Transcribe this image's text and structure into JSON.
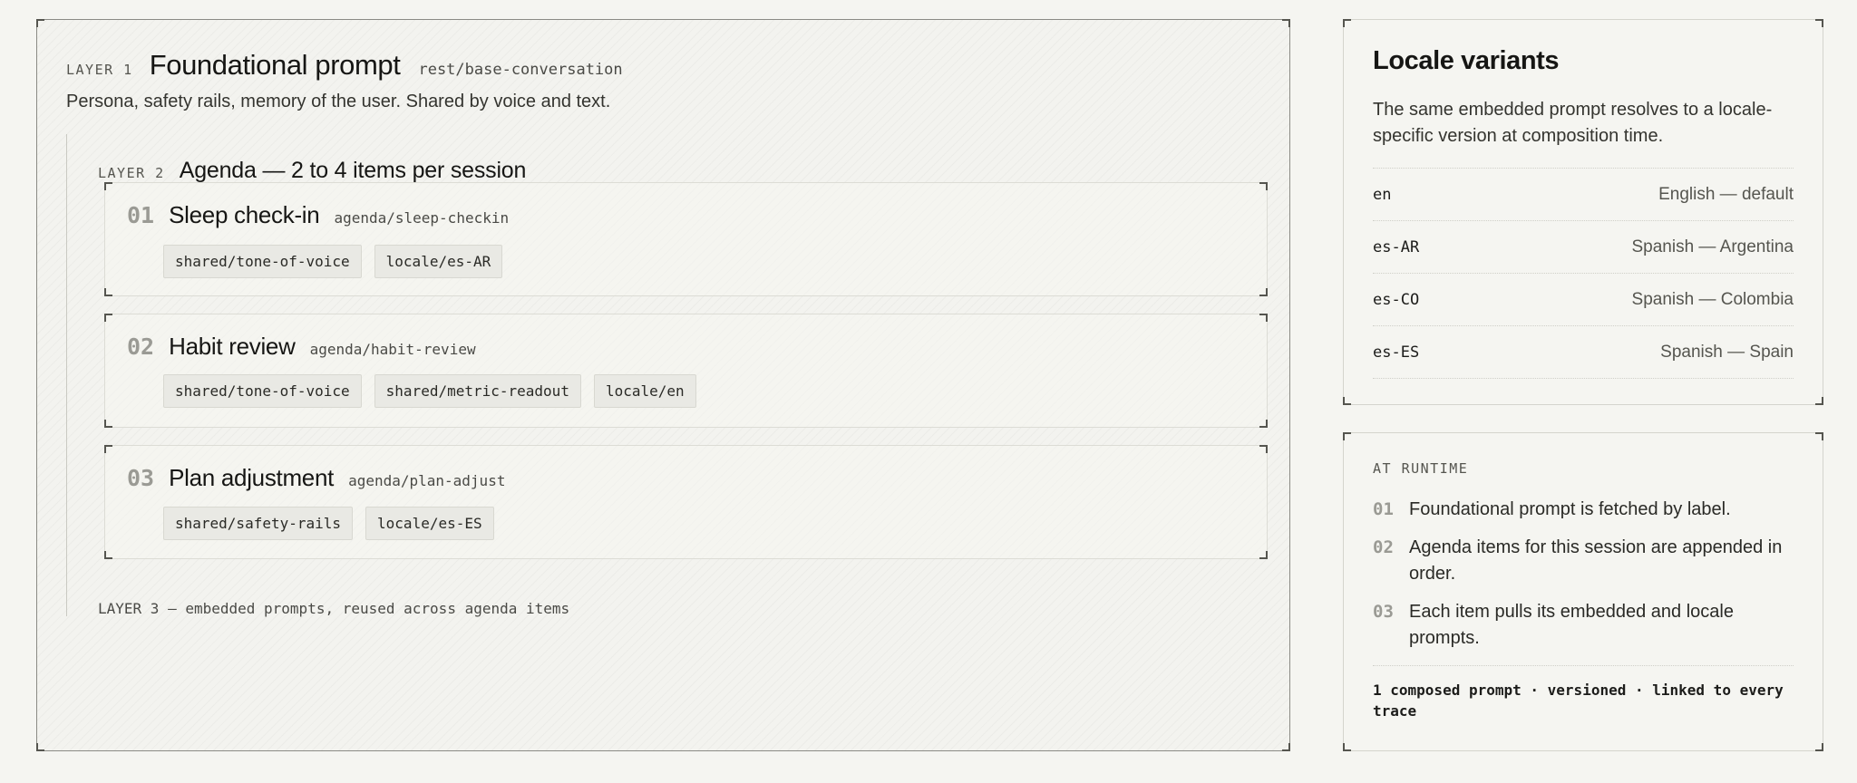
{
  "foundational": {
    "layer_tag": "LAYER 1",
    "title": "Foundational prompt",
    "path": "rest/base-conversation",
    "description": "Persona, safety rails, memory of the user. Shared by voice and text."
  },
  "agenda": {
    "layer_tag": "LAYER 2",
    "title": "Agenda — 2 to 4 items per session",
    "items": [
      {
        "num": "01",
        "title": "Sleep check-in",
        "path": "agenda/sleep-checkin",
        "chips": [
          "shared/tone-of-voice",
          "locale/es-AR"
        ]
      },
      {
        "num": "02",
        "title": "Habit review",
        "path": "agenda/habit-review",
        "chips": [
          "shared/tone-of-voice",
          "shared/metric-readout",
          "locale/en"
        ]
      },
      {
        "num": "03",
        "title": "Plan adjustment",
        "path": "agenda/plan-adjust",
        "chips": [
          "shared/safety-rails",
          "locale/es-ES"
        ]
      }
    ],
    "layer3_note": "LAYER 3 — embedded prompts, reused across agenda items"
  },
  "locales": {
    "title": "Locale variants",
    "description": "The same embedded prompt resolves to a locale-specific version at composition time.",
    "rows": [
      {
        "code": "en",
        "name": "English — default"
      },
      {
        "code": "es-AR",
        "name": "Spanish — Argentina"
      },
      {
        "code": "es-CO",
        "name": "Spanish — Colombia"
      },
      {
        "code": "es-ES",
        "name": "Spanish — Spain"
      }
    ]
  },
  "runtime": {
    "label": "AT RUNTIME",
    "steps": [
      {
        "num": "01",
        "text": "Foundational prompt is fetched by label."
      },
      {
        "num": "02",
        "text": "Agenda items for this session are appended in order."
      },
      {
        "num": "03",
        "text": "Each item pulls its embedded and locale prompts."
      }
    ],
    "footer": "1 composed prompt · versioned · linked to every trace"
  }
}
